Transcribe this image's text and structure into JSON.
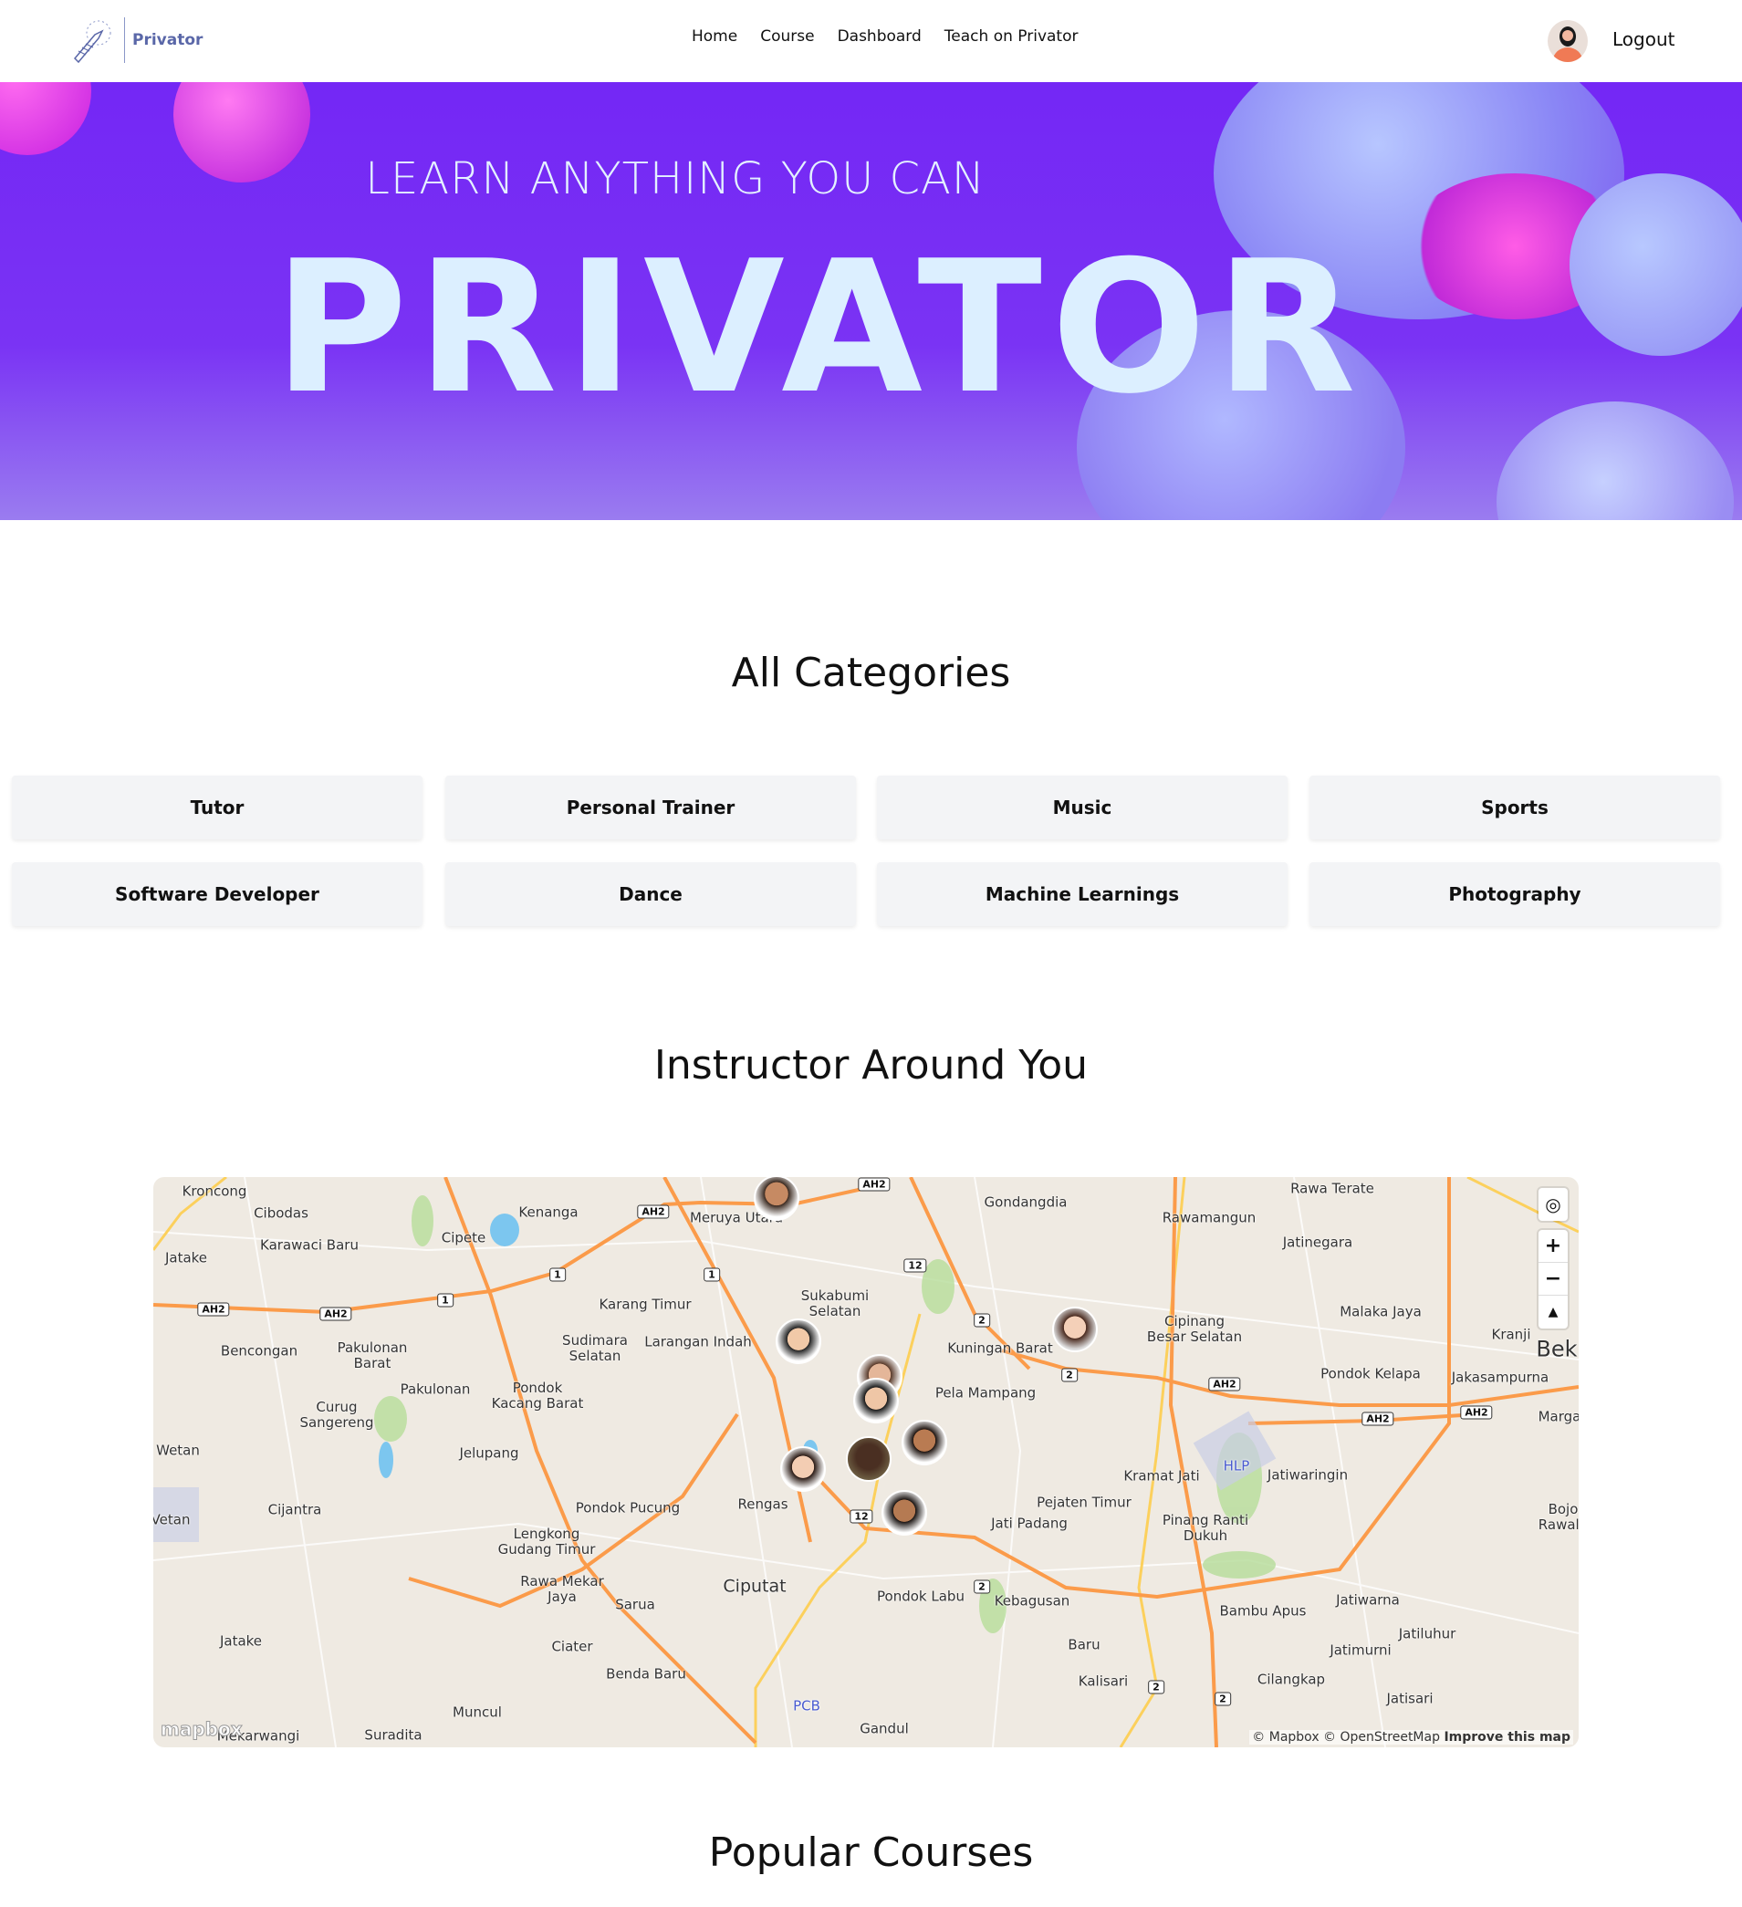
{
  "nav": {
    "brand": "Privator",
    "links": [
      "Home",
      "Course",
      "Dashboard",
      "Teach on Privator"
    ],
    "logout": "Logout"
  },
  "hero": {
    "subtitle": "LEARN ANYTHING YOU CAN",
    "title": "PRIVATOR",
    "color": "#7427f5"
  },
  "categories": {
    "title": "All Categories",
    "items": [
      "Tutor",
      "Personal Trainer",
      "Music",
      "Sports",
      "Software Developer",
      "Dance",
      "Machine Learnings",
      "Photography"
    ]
  },
  "map": {
    "title": "Instructor Around You",
    "labels": [
      "Kroncong",
      "Cibodas",
      "Kenanga",
      "Meruya Utara",
      "Gondangdia",
      "Rawamangun",
      "Rawa Terate",
      "Jatinegara",
      "Jatake",
      "Karawaci Baru",
      "Cipete",
      "Sukabumi\nSelatan",
      "Karang Timur",
      "Malaka Jaya",
      "Kranji",
      "Bek",
      "Cipinang\nBesar Selatan",
      "Kuningan Barat",
      "Bencongan",
      "Pakulonan\nBarat",
      "Sudimara\nSelatan",
      "Larangan Indah",
      "Pondok Kelapa",
      "Jakasampurna",
      "Pela Mampang",
      "Pakulonan",
      "Pondok\nKacang Barat",
      "Curug\nSangereng",
      "Marga",
      "Wetan",
      "Jelupang",
      "Kramat Jati",
      "HLP",
      "Jatiwaringin",
      "Rengas",
      "Pondok Pucung",
      "Pejaten Timur",
      "Jati Padang",
      "Cijantra",
      "Vetan",
      "Pinang Ranti\nDukuh",
      "Bojo\nRawalu",
      "Lengkong\nGudang Timur",
      "Rawa Mekar\nJaya",
      "Sarua",
      "Ciputat",
      "Pondok Labu",
      "Kebagusan",
      "Bambu Apus",
      "Jatiwarna",
      "Jatiluhur",
      "Jatimurni",
      "Jatake",
      "Ciater",
      "Baru",
      "Benda Baru",
      "Kalisari",
      "Cilangkap",
      "Jatisari",
      "Muncul",
      "Mekarwangi",
      "Suradita",
      "Gandul",
      "PCB"
    ],
    "shields": [
      "AH2",
      "AH2",
      "AH2",
      "AH2",
      "1",
      "1",
      "1",
      "12",
      "12",
      "2",
      "2",
      "2",
      "2",
      "2",
      "AH2",
      "AH2",
      "AH2"
    ],
    "controls": {
      "zoom_in": "+",
      "zoom_out": "−",
      "compass": "▲"
    },
    "logo": "mapbox",
    "attribution": "© Mapbox © OpenStreetMap",
    "improve": "Improve this map",
    "instructor_count": 9
  },
  "popular": {
    "title": "Popular Courses"
  }
}
